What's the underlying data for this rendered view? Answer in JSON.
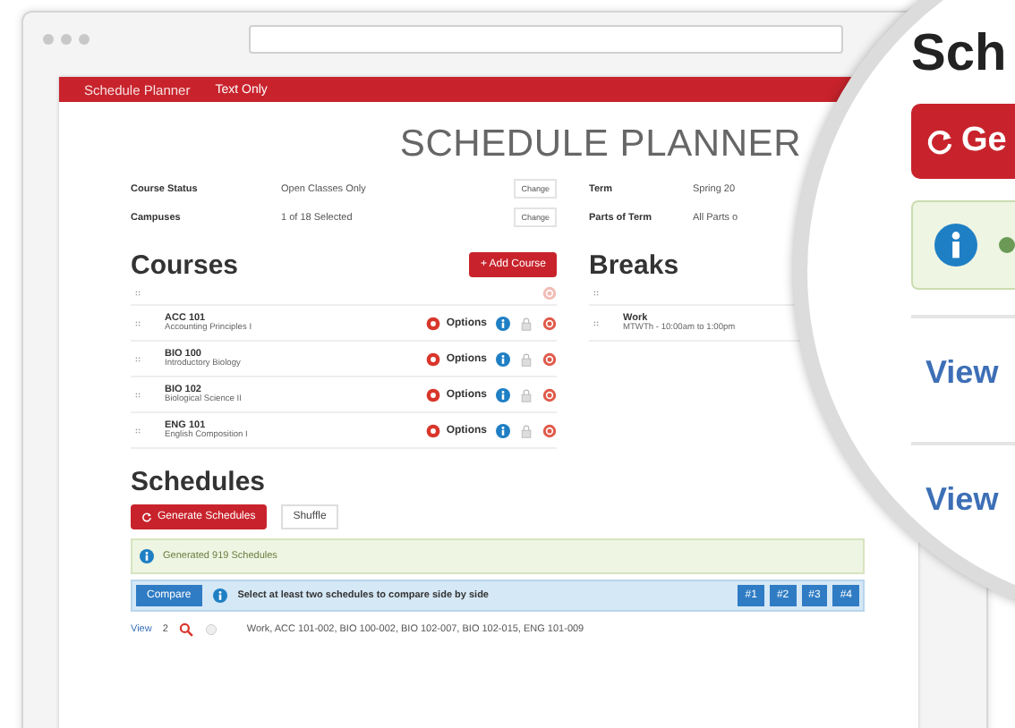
{
  "nav": [
    "Schedule Planner",
    "Text Only"
  ],
  "title": "SCHEDULE PLANNER",
  "settings": [
    {
      "label": "Course Status",
      "value": "Open Classes Only",
      "action": "Change"
    },
    {
      "label": "Campuses",
      "value": "1 of 18 Selected",
      "action": "Change"
    }
  ],
  "term_settings": [
    {
      "label": "Term",
      "value": "Spring 20"
    },
    {
      "label": "Parts of Term",
      "value": "All Parts o"
    }
  ],
  "courses": {
    "heading": "Courses",
    "add_button": "+ Add Course",
    "items": [
      {
        "code": "ACC 101",
        "name": "Accounting Principles I",
        "options": "Options"
      },
      {
        "code": "BIO 100",
        "name": "Introductory Biology",
        "options": "Options"
      },
      {
        "code": "BIO 102",
        "name": "Biological Science II",
        "options": "Options"
      },
      {
        "code": "ENG 101",
        "name": "English Composition I",
        "options": "Options"
      }
    ]
  },
  "breaks": {
    "heading": "Breaks",
    "items": [
      {
        "name": "Work",
        "time": "MTWTh - 10:00am to 1:00pm"
      }
    ]
  },
  "schedules": {
    "heading": "Schedules",
    "generate_button": "Generate Schedules",
    "shuffle_button": "Shuffle",
    "message": "Generated 919 Schedules",
    "compare_button": "Compare",
    "compare_hint": "Select at least two schedules to compare side by side",
    "slots": [
      "#1",
      "#2",
      "#3",
      "#4"
    ],
    "rows": [
      {
        "link": "View",
        "number": "2",
        "sections": "Work, ACC 101-002, BIO 100-002, BIO 102-007, BIO 102-015, ENG 101-009"
      }
    ]
  },
  "magnifier": {
    "heading": "Sch",
    "button": "Ge",
    "links": [
      "View",
      "View"
    ]
  }
}
